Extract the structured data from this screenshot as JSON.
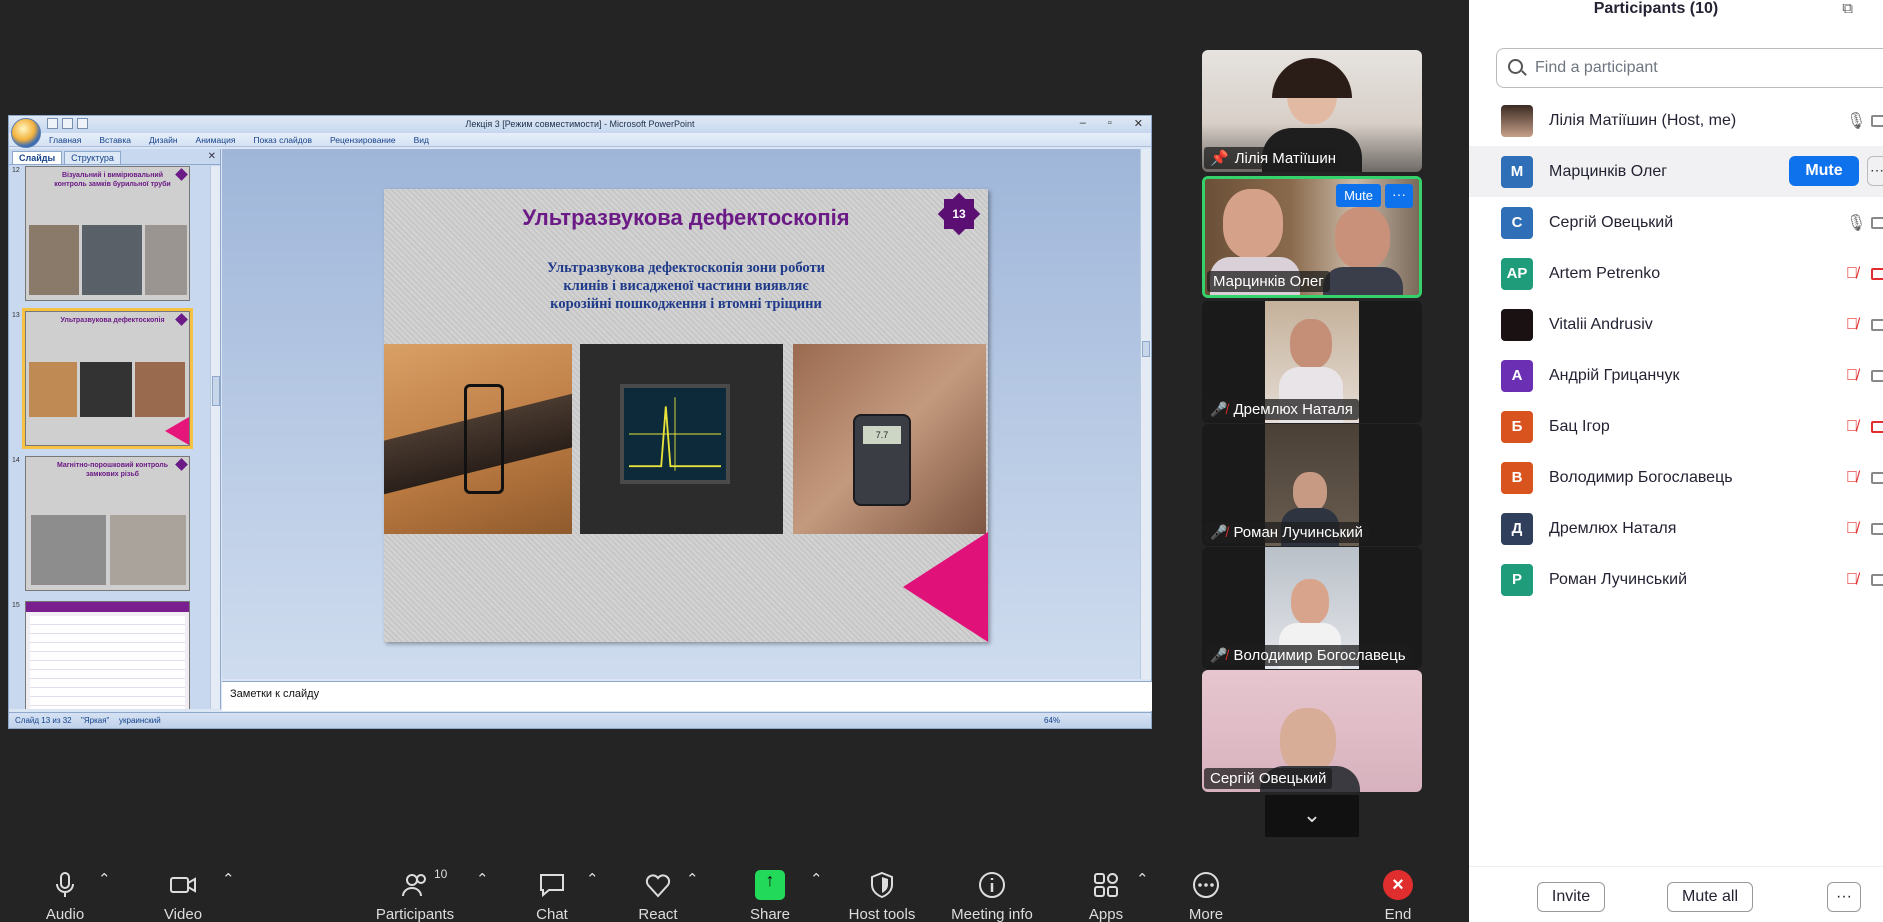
{
  "powerpoint": {
    "window_title": "Лекція 3 [Режим совместимости] - Microsoft PowerPoint",
    "menu": [
      "Главная",
      "Вставка",
      "Дизайн",
      "Анимация",
      "Показ слайдов",
      "Рецензирование",
      "Вид"
    ],
    "pane_tabs": [
      "Слайды",
      "Структура"
    ],
    "thumbnails": [
      {
        "num": "12",
        "title": "Візуальний і вимірювальний контроль замків бурильної труби"
      },
      {
        "num": "13",
        "title": "Ультразвукова дефектоскопія"
      },
      {
        "num": "14",
        "title": "Магнітно-порошковий контроль замкових різьб"
      },
      {
        "num": "15",
        "title": ""
      }
    ],
    "slide": {
      "title": "Ультразвукова дефектоскопія",
      "number": "13",
      "body_lines": [
        "Ультразвукова дефектоскопія зони роботи",
        "клинів і висадженої частини виявляє",
        "корозійні пошкодження і втомні тріщини"
      ],
      "device_reading": "7.7"
    },
    "notes_placeholder": "Заметки к слайду",
    "status": {
      "slide": "Слайд 13 из 32",
      "theme": "\"Яркая\"",
      "language": "украинский",
      "zoom": "64%"
    }
  },
  "video_tiles": [
    {
      "name": "Лілія Матіїшин",
      "pinned": true,
      "muted": false
    },
    {
      "name": "Марцинків Олег",
      "muted": false,
      "mute_label": "Mute",
      "more_label": "···"
    },
    {
      "name": "Дремлюх Наталя",
      "muted": true
    },
    {
      "name": "Роман Лучинський",
      "muted": true
    },
    {
      "name": "Володимир Богославець",
      "muted": true
    },
    {
      "name": "Сергій Овецький",
      "muted": false
    }
  ],
  "panel": {
    "title": "Participants (10)",
    "search_placeholder": "Find a participant",
    "participants": [
      {
        "initials": "",
        "name": "Лілія Матіїшин (Host, me)",
        "color": "#8a6d5a",
        "mic": "on",
        "cam": "on"
      },
      {
        "initials": "M",
        "name": "Марцинків Олег",
        "color": "#2e6fb8",
        "mic": "on",
        "cam": "on",
        "action": "Mute"
      },
      {
        "initials": "C",
        "name": "Сергій Овецький",
        "color": "#2e6fb8",
        "mic": "on",
        "cam": "on"
      },
      {
        "initials": "AP",
        "name": "Artem Petrenko",
        "color": "#1f9c7a",
        "mic": "off",
        "cam": "off"
      },
      {
        "initials": "",
        "name": "Vitalii Andrusiv",
        "color": "#1a1212",
        "mic": "off",
        "cam": "on"
      },
      {
        "initials": "A",
        "name": "Андрій Грицанчук",
        "color": "#6b2fb3",
        "mic": "off",
        "cam": "on"
      },
      {
        "initials": "Б",
        "name": "Бац Ігор",
        "color": "#d9531e",
        "mic": "off",
        "cam": "off"
      },
      {
        "initials": "B",
        "name": "Володимир Богославець",
        "color": "#d9531e",
        "mic": "off",
        "cam": "on"
      },
      {
        "initials": "Д",
        "name": "Дремлюх Наталя",
        "color": "#2f3f5c",
        "mic": "off",
        "cam": "on"
      },
      {
        "initials": "P",
        "name": "Роман Лучинський",
        "color": "#1f9c7a",
        "mic": "off",
        "cam": "on"
      }
    ],
    "invite_label": "Invite",
    "mute_all_label": "Mute all",
    "more_label": "···"
  },
  "toolbar": {
    "audio": "Audio",
    "video": "Video",
    "participants": "Participants",
    "participants_count": "10",
    "chat": "Chat",
    "react": "React",
    "share": "Share",
    "host_tools": "Host tools",
    "meeting_info": "Meeting info",
    "apps": "Apps",
    "more": "More",
    "end": "End"
  }
}
